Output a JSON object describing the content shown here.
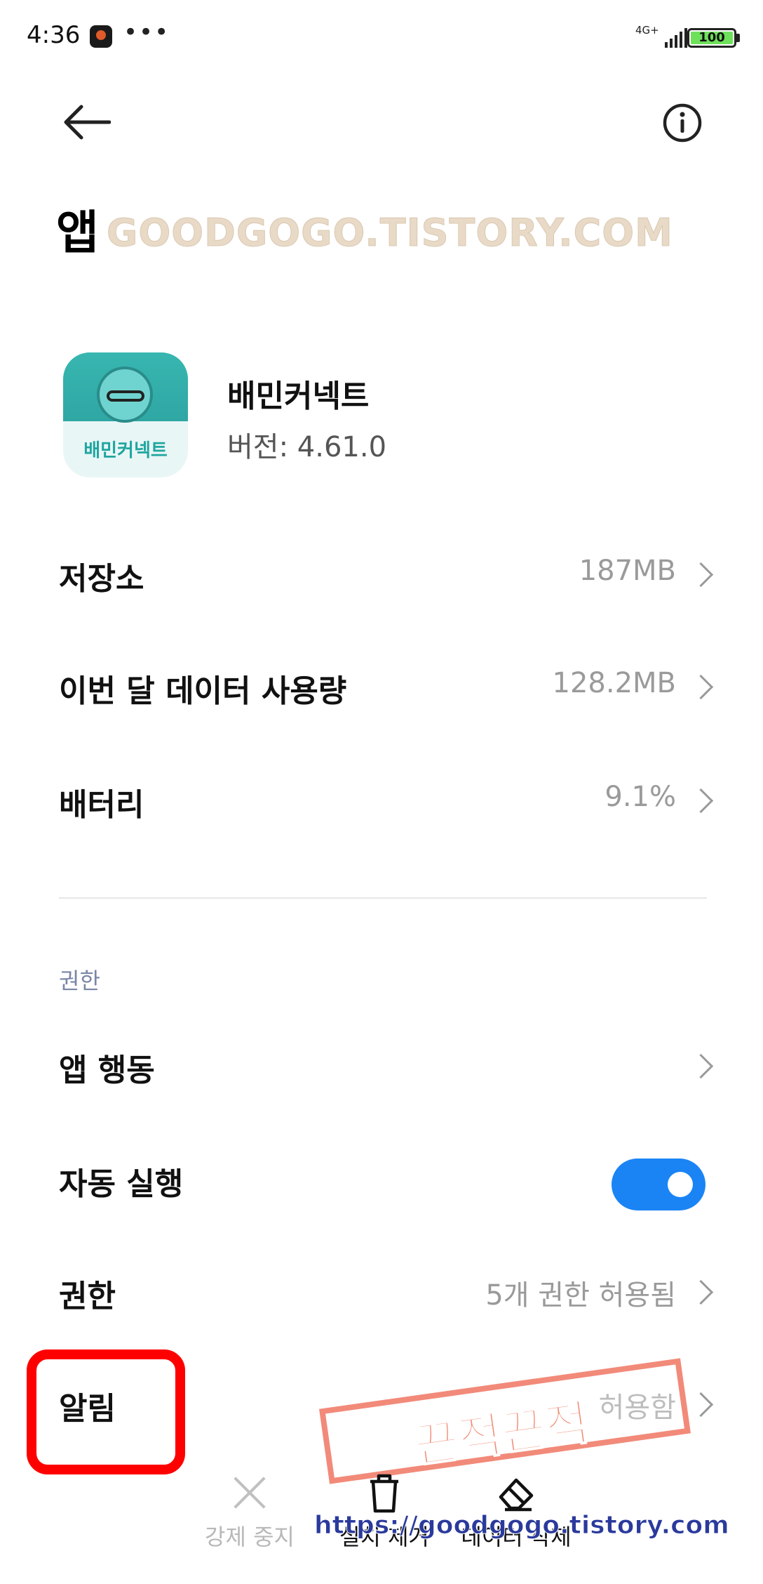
{
  "status_bar": {
    "time": "4:36",
    "dots": "•••",
    "network": "4G+",
    "battery": "100",
    "battery_color": "#6ee15a"
  },
  "header": {
    "back_icon": "arrow-left-icon",
    "info_icon": "info-circle-icon",
    "page_title": "앱",
    "watermark": "GOODGOGO.TISTORY.COM"
  },
  "app": {
    "name": "배민커넥트",
    "version": "버전: 4.61.0",
    "icon_label": "배민커넥트"
  },
  "usage": [
    {
      "label": "저장소",
      "value": "187MB"
    },
    {
      "label": "이번 달 데이터 사용량",
      "value": "128.2MB"
    },
    {
      "label": "배터리",
      "value": "9.1%"
    }
  ],
  "permissions": {
    "section_title": "권한",
    "app_behavior": {
      "label": "앱 행동"
    },
    "autostart": {
      "label": "자동 실행",
      "enabled": true,
      "toggle_color": "#1a84f5"
    },
    "permissions_row": {
      "label": "권한",
      "value": "5개 권한 허용됨"
    },
    "notifications": {
      "label": "알림",
      "value": "허용함"
    }
  },
  "overlay": {
    "stamp_text": "끈적끈적",
    "link": "https://goodgogo.tistory.com",
    "highlight_color": "#ff0000"
  },
  "actions": [
    {
      "label": "강제 중지",
      "icon": "close-icon",
      "enabled": false
    },
    {
      "label": "설치 제거",
      "icon": "trash-icon",
      "enabled": true
    },
    {
      "label": "데이터 삭제",
      "icon": "eraser-icon",
      "enabled": true
    }
  ]
}
